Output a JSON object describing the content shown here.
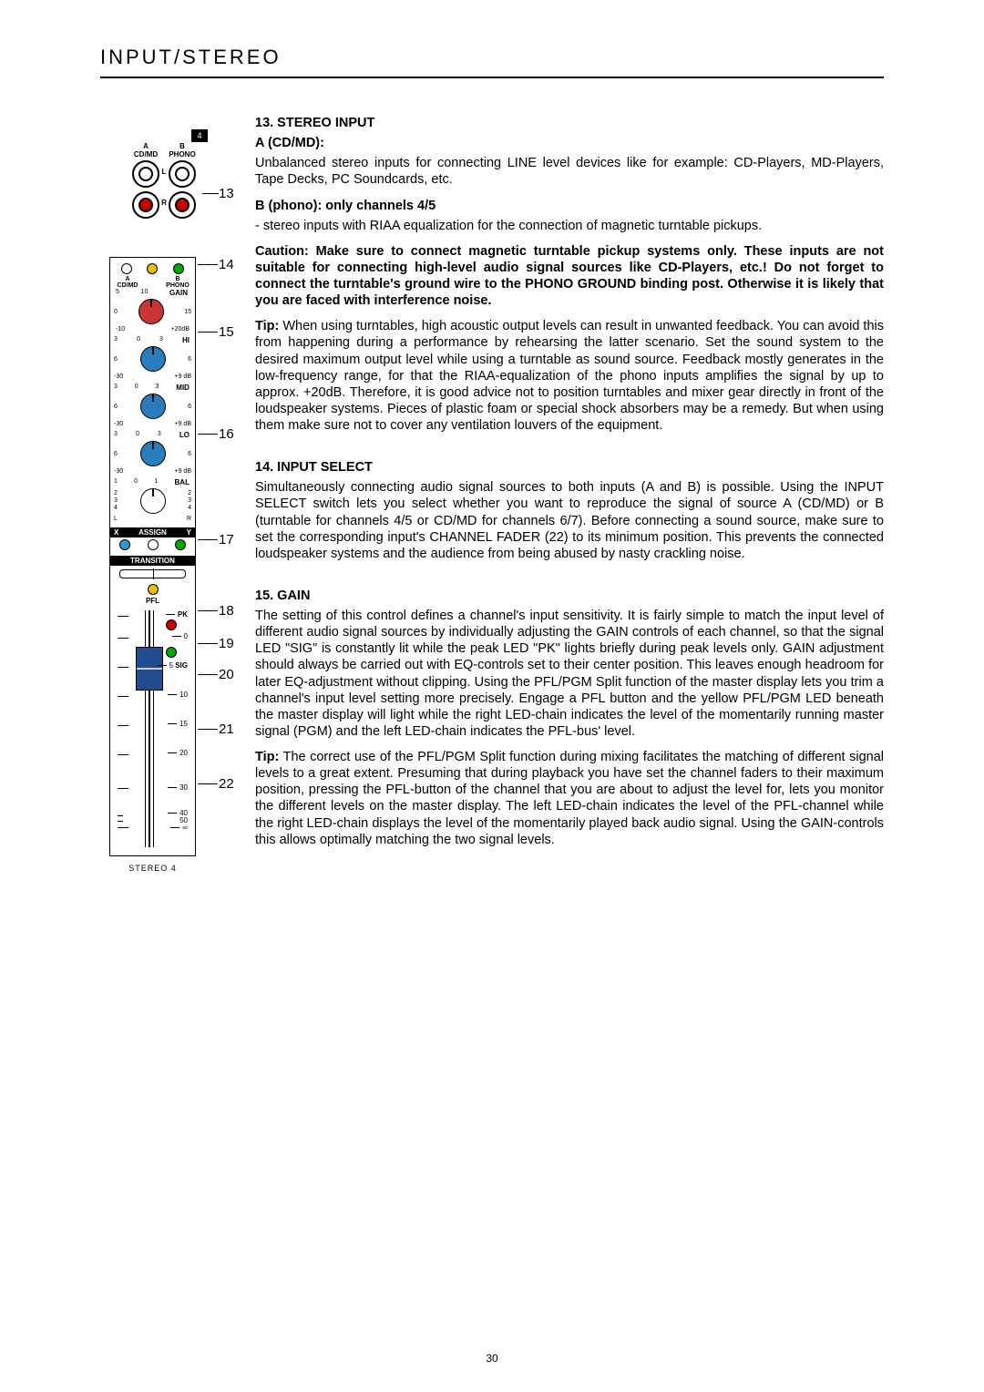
{
  "header": {
    "title": "INPUT/STEREO"
  },
  "page_number": "30",
  "callouts": {
    "n13": "13",
    "n14": "14",
    "n15": "15",
    "n16": "16",
    "n17": "17",
    "n18": "18",
    "n19": "19",
    "n20": "20",
    "n21": "21",
    "n22": "22"
  },
  "jackpanel": {
    "badge": "4",
    "colA_top": "A",
    "colA_bot": "CD/MD",
    "colB_top": "B",
    "colB_bot": "PHONO",
    "L": "L",
    "R": "R"
  },
  "strip": {
    "input_a_top": "A",
    "input_a_bot": "CD/MD",
    "input_b_top": "B",
    "input_b_bot": "PHONO",
    "gain_label": "GAIN",
    "gain_scale": {
      "l1": "5",
      "c": "10",
      "l2": "0",
      "r2": "15",
      "bl": "-10",
      "br": "+20dB"
    },
    "hi": "HI",
    "mid": "MID",
    "lo": "LO",
    "eq_top": {
      "l": "3",
      "c": "0",
      "r": "3"
    },
    "eq_mid": {
      "l": "6",
      "r": "6"
    },
    "eq_bot": {
      "l": "-30",
      "r": "+9 dB"
    },
    "bal": "BAL",
    "bal_scale": {
      "t": {
        "l": "1",
        "c": "0",
        "r": "1"
      },
      "m": {
        "l": "2",
        "r": "2"
      },
      "m2": {
        "l": "3",
        "r": "3"
      },
      "b": {
        "l": "4",
        "r": "4"
      },
      "lr": {
        "l": "L",
        "r": "R"
      }
    },
    "assign": {
      "x": "X",
      "label": "ASSIGN",
      "y": "Y"
    },
    "transition": "TRANSITION",
    "pfl": "PFL",
    "pk": "PK",
    "sig": "SIG",
    "fader_marks": {
      "m0": "0",
      "m5": "5",
      "m10": "10",
      "m15": "15",
      "m20": "20",
      "m30": "30",
      "m40": "40",
      "m50": "50",
      "minf": "∞"
    },
    "strip_label": "STEREO 4"
  },
  "text": {
    "s13_title": "13. STEREO INPUT",
    "s13_a_label": "A (CD/MD):",
    "s13_a_body": "Unbalanced stereo inputs for connecting LINE level devices like for example: CD-Players, MD-Players, Tape Decks, PC Soundcards, etc.",
    "s13_b_label": "B (phono): only channels 4/5",
    "s13_b_body": "- stereo inputs with RIAA equalization for the connection of magnetic turntable pickups.",
    "s13_caution": "Caution: Make sure to connect magnetic turntable pickup systems only. These inputs are not suitable for connecting high-level audio signal sources like CD-Players, etc.! Do not forget to connect the turntable's ground wire to the PHONO GROUND binding post. Otherwise it is likely that you are faced with interference noise.",
    "s13_tip_label": "Tip:",
    "s13_tip_body": " When using turntables, high acoustic output levels can result in unwanted feedback. You can avoid this from happening during a performance by rehearsing the latter scenario. Set the sound system to the desired maximum output level while using a turntable as sound source. Feedback mostly generates in the low-frequency range, for that the RIAA-equalization of the phono inputs amplifies the signal by up to approx. +20dB. Therefore, it is good advice not to position turntables and mixer gear directly in front of the loudspeaker systems. Pieces of plastic foam or special shock absorbers may be a remedy. But when using them make sure not to cover any ventilation louvers of the equipment.",
    "s14_title": "14. INPUT SELECT",
    "s14_body": "Simultaneously connecting audio signal sources to both inputs (A and B) is possible. Using the INPUT SELECT switch lets you select whether you want to reproduce the signal of source A (CD/MD) or B (turntable for channels 4/5 or CD/MD for channels 6/7). Before connecting a sound source, make sure to set the corresponding input's CHANNEL FADER (22) to its minimum position. This prevents the connected loudspeaker systems and the audience from being abused by nasty crackling noise.",
    "s15_title": "15. GAIN",
    "s15_body": "The setting of this control defines a channel's input sensitivity. It is fairly simple to match the input level of different audio signal sources by individually adjusting the GAIN controls of each channel, so that the signal LED \"SIG\" is constantly lit while the peak LED \"PK\" lights briefly during peak levels only. GAIN adjustment should always be carried out with EQ-controls set to their center position. This leaves enough headroom for later EQ-adjustment without clipping. Using the PFL/PGM Split function of the master display lets you trim a channel's input level setting more precisely. Engage a PFL button and the yellow PFL/PGM LED beneath the master display will light while the right LED-chain indicates the level of the momentarily running master signal (PGM) and the left LED-chain indicates the PFL-bus' level.",
    "s15_tip_label": "Tip:",
    "s15_tip_body": " The correct use of the PFL/PGM Split function during mixing facilitates the matching of different signal levels to a great extent. Presuming that during playback you have set the channel faders to their maximum position, pressing the PFL-button of the channel that you are about to adjust the level for, lets you monitor the different levels on the master display. The left LED-chain indicates the level of the PFL-channel while the right LED-chain displays the level of the momentarily played back audio signal. Using the GAIN-controls this allows optimally matching the two signal levels."
  }
}
